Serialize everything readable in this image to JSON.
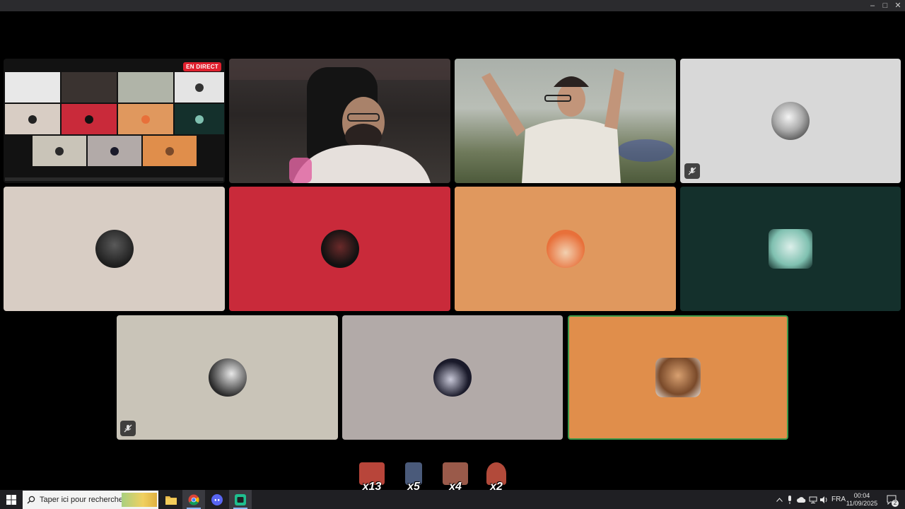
{
  "window": {
    "minimize": "–",
    "maximize": "□",
    "close": "✕"
  },
  "stream_tile": {
    "live_label": "EN DIRECT"
  },
  "participants": [
    {
      "id": "p-row2-1",
      "bg": "#d8cdc4",
      "avatar_colors": [
        "#1e1e1e",
        "#5a5a5a"
      ]
    },
    {
      "id": "p-row2-2",
      "bg": "#c92a3a",
      "avatar_colors": [
        "#111111",
        "#6a2a2a"
      ]
    },
    {
      "id": "p-row2-3",
      "bg": "#e0985e",
      "avatar_colors": [
        "#e8703a",
        "#f2d0b0"
      ]
    },
    {
      "id": "p-row2-4",
      "bg": "#14302c",
      "avatar_colors": [
        "#7fc0b0",
        "#dcefea"
      ]
    },
    {
      "id": "p-row3-1",
      "bg": "#c9c4b8",
      "avatar_colors": [
        "#2a2a2a",
        "#e8e8e8"
      ]
    },
    {
      "id": "p-row3-2",
      "bg": "#b2aaa8",
      "avatar_colors": [
        "#1a1a2a",
        "#c8c8d8"
      ]
    },
    {
      "id": "p-row3-3",
      "bg": "#e08e4b",
      "avatar_colors": [
        "#7a4a2a",
        "#d8a070"
      ]
    }
  ],
  "gray_tile": {
    "bg": "#d8d8d8"
  },
  "reactions": [
    {
      "count": "x13",
      "color": "#b8453a"
    },
    {
      "count": "x5",
      "color": "#4a5a7a"
    },
    {
      "count": "x4",
      "color": "#9a5a4a"
    },
    {
      "count": "x2",
      "color": "#b24a3a"
    }
  ],
  "taskbar": {
    "search_placeholder": "Taper ici pour rechercher",
    "language": "FRA",
    "time": "00:04",
    "date": "11/09/2025",
    "notifications": "2"
  }
}
